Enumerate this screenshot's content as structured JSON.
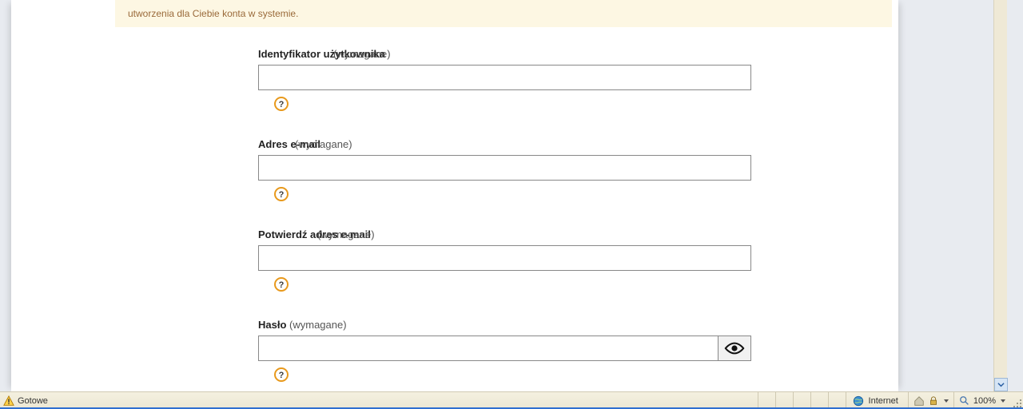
{
  "notice": {
    "text": "utworzenia dla Ciebie konta w systemie."
  },
  "form": {
    "username": {
      "label_bold": "Identyfikator użytkownika",
      "label_req": "(wymagane)",
      "value": ""
    },
    "email": {
      "label_bold": "Adres e-mail",
      "label_req": "(wymagane)",
      "value": ""
    },
    "email2": {
      "label_bold": "Potwierdź adres e-mail",
      "label_req": "(wymagane)",
      "value": ""
    },
    "password": {
      "label_bold": "Hasło",
      "label_req": "(wymagane)",
      "value": ""
    },
    "help_symbol": "?"
  },
  "statusbar": {
    "ready": "Gotowe",
    "zone": "Internet",
    "zoom": "100%"
  }
}
